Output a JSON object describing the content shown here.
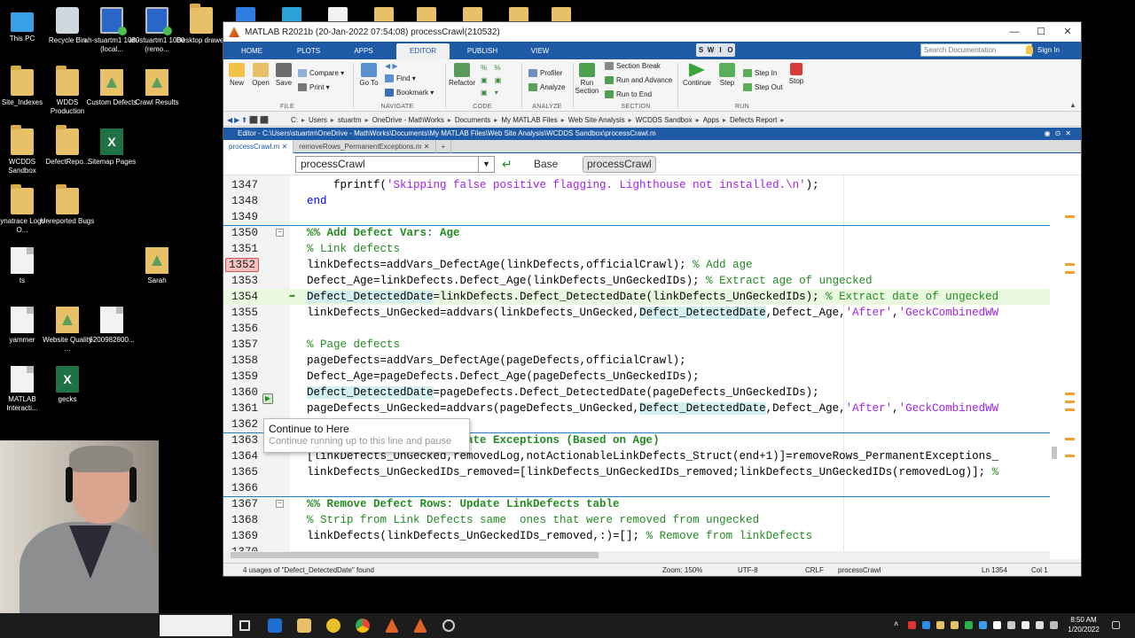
{
  "desktop": {
    "icons": [
      {
        "label": "This PC",
        "icon": "pc-icon"
      },
      {
        "label": "Recycle Bin",
        "icon": "recycle-bin-icon"
      },
      {
        "label": "ah-stuartm1 1080 (local...",
        "icon": "remote-desktop-icon"
      },
      {
        "label": "ah-stuartm1 1080 (remo...",
        "icon": "remote-desktop-icon"
      },
      {
        "label": "Desktop drawer",
        "icon": "folder-icon"
      },
      {
        "label": "Site_Indexes",
        "icon": "folder-icon"
      },
      {
        "label": "WDDS Production",
        "icon": "folder-icon"
      },
      {
        "label": "Custom Defects",
        "icon": "matlab-folder-icon"
      },
      {
        "label": "Crawl Results",
        "icon": "matlab-folder-icon"
      },
      {
        "label": "WCDDS Sandbox",
        "icon": "folder-icon"
      },
      {
        "label": "DefectRepo...",
        "icon": "folder-icon"
      },
      {
        "label": "Sitemap Pages",
        "icon": "excel-icon"
      },
      {
        "label": "Dynatrace Logs - O...",
        "icon": "folder-icon"
      },
      {
        "label": "Unreported Bugs",
        "icon": "folder-icon"
      },
      {
        "label": "ts",
        "icon": "matlab-file-icon"
      },
      {
        "label": "Sarah",
        "icon": "matlab-folder-icon"
      },
      {
        "label": "yammer",
        "icon": "document-icon"
      },
      {
        "label": "Website Quality ...",
        "icon": "matlab-folder-icon"
      },
      {
        "label": "6200982800...",
        "icon": "document-icon"
      },
      {
        "label": "MATLAB Interacti...",
        "icon": "document-icon"
      },
      {
        "label": "gecks",
        "icon": "excel-icon"
      }
    ]
  },
  "window": {
    "title": "MATLAB R2021b (20-Jan-2022 07:54:08) processCrawl(210532)",
    "controls": {
      "minimize": "—",
      "maximize": "☐",
      "close": "✕"
    }
  },
  "ribbon_tabs": [
    "HOME",
    "PLOTS",
    "APPS",
    "EDITOR",
    "PUBLISH",
    "VIEW"
  ],
  "active_tab": "EDITOR",
  "quick_access": [
    "S",
    "W",
    "I",
    "O"
  ],
  "search_placeholder": "Search Documentation",
  "signin": "Sign In",
  "ribbon": {
    "file": {
      "new": "New",
      "open": "Open",
      "save": "Save",
      "compare": "Compare",
      "print": "Print",
      "group": "FILE"
    },
    "navigate": {
      "goto": "Go To",
      "find": "Find",
      "bookmark": "Bookmark",
      "group": "NAVIGATE"
    },
    "code": {
      "refactor": "Refactor",
      "group": "CODE"
    },
    "analyze": {
      "profiler": "Profiler",
      "analyze": "Analyze",
      "group": "ANALYZE"
    },
    "section": {
      "run_section": "Run Section",
      "section_break": "Section Break",
      "run_advance": "Run and Advance",
      "run_end": "Run to End",
      "group": "SECTION"
    },
    "run": {
      "continue": "Continue",
      "step": "Step",
      "step_in": "Step In",
      "step_out": "Step Out",
      "stop": "Stop",
      "group": "RUN"
    }
  },
  "address": [
    "C:",
    "Users",
    "stuartm",
    "OneDrive - MathWorks",
    "Documents",
    "My MATLAB Files",
    "Web Site Analysis",
    "WCDDS Sandbox",
    "Apps",
    "Defects Report"
  ],
  "editor_title": "Editor - C:\\Users\\stuartm\\OneDrive - MathWorks\\Documents\\My MATLAB Files\\Web Site Analysis\\WCDDS Sandbox\\processCrawl.m",
  "file_tabs": [
    "processCrawl.m",
    "removeRows_PermanentExceptions.m"
  ],
  "function_selector": "processCrawl",
  "base_button": "Base",
  "crawl_button": "processCrawl",
  "tooltip": {
    "title": "Continue to Here",
    "subtitle": "Continue running up to this line and pause"
  },
  "status": {
    "message": "4 usages of \"Defect_DetectedDate\" found",
    "zoom": "Zoom: 150%",
    "encoding": "UTF-8",
    "eol": "CRLF",
    "function": "processCrawl",
    "ln": "Ln  1354",
    "col": "Col  1"
  },
  "taskbar": {
    "time": "8:50 AM",
    "date": "1/20/2022"
  }
}
